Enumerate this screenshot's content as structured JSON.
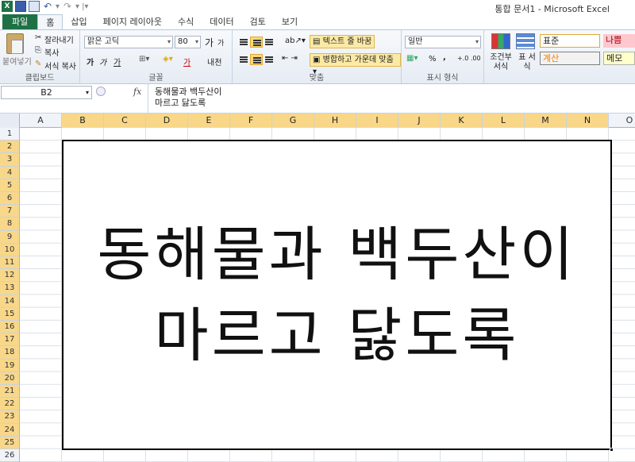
{
  "window": {
    "title": "통합 문서1  -  Microsoft Excel",
    "qat_logo": "X"
  },
  "tabs": [
    "파일",
    "홈",
    "삽입",
    "페이지 레이아웃",
    "수식",
    "데이터",
    "검토",
    "보기"
  ],
  "ribbon": {
    "clipboard": {
      "paste": "붙여넣기",
      "cut": "잘라내기",
      "copy": "복사",
      "format_painter": "서식 복사",
      "label": "클립보드"
    },
    "font": {
      "font_name": "맑은 고딕",
      "font_size": "80",
      "grow": "가",
      "shrink": "가",
      "bold": "가",
      "italic": "가",
      "underline": "가",
      "font_color_glyph": "가",
      "phonetic": "내천",
      "label": "글꼴"
    },
    "alignment": {
      "wrap_text": "텍스트 줄 바꿈",
      "merge_center": "병합하고 가운데 맞춤",
      "label": "맞춤"
    },
    "number": {
      "format": "일반",
      "percent": "%",
      "comma": ",",
      "inc_dec": "+.0 .00",
      "dec_dec": ".00 +.0",
      "label": "표시 형식"
    },
    "styles": {
      "conditional": "조건부 서식",
      "table": "표 서식",
      "normal": "표준",
      "bad": "나쁨",
      "calc": "계산",
      "note": "메모"
    }
  },
  "formula_bar": {
    "name_box": "B2",
    "fx": "fx",
    "content_line1": "동해물과 백두산이",
    "content_line2": "마르고 닳도록"
  },
  "sheet": {
    "columns": [
      "A",
      "B",
      "C",
      "D",
      "E",
      "F",
      "G",
      "H",
      "I",
      "J",
      "K",
      "L",
      "M",
      "N",
      "O"
    ],
    "selected_columns": [
      "B",
      "C",
      "D",
      "E",
      "F",
      "G",
      "H",
      "I",
      "J",
      "K",
      "L",
      "M",
      "N"
    ],
    "rows": [
      "1",
      "2",
      "3",
      "4",
      "5",
      "6",
      "7",
      "8",
      "9",
      "10",
      "11",
      "12",
      "13",
      "14",
      "15",
      "16",
      "17",
      "18",
      "19",
      "20",
      "21",
      "22",
      "23",
      "24",
      "25",
      "26"
    ],
    "selected_rows_from": 2,
    "selected_rows_to": 25,
    "merged_cell_line1": "동해물과 백두산이",
    "merged_cell_line2": "마르고 닳도록"
  },
  "colors": {
    "file_tab": "#1e7145",
    "selection_header": "#f8d789",
    "highlight_button": "#fce9a4"
  }
}
